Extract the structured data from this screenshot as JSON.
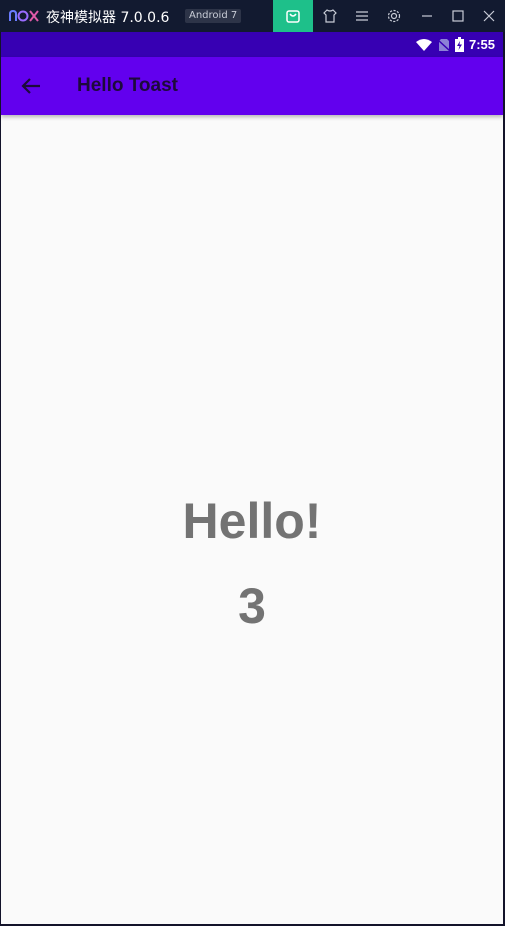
{
  "emulator": {
    "title": "夜神模拟器 7.0.0.6",
    "android_badge": "Android 7",
    "icons": [
      "nox-logo-icon",
      "store-icon",
      "shirt-icon",
      "menu-icon",
      "gear-icon",
      "minimize-icon",
      "maximize-icon",
      "close-icon"
    ],
    "colors": {
      "titlebar": "#121a30",
      "store_accent": "#1ec08a"
    }
  },
  "statusbar": {
    "time": "7:55",
    "icons": [
      "wifi-icon",
      "no-sim-icon",
      "battery-charging-icon"
    ],
    "color": "#3700b3"
  },
  "appbar": {
    "title": "Hello Toast",
    "back_icon": "arrow-back-icon",
    "color": "#6200ee"
  },
  "main": {
    "hello_text": "Hello!",
    "count_text": "3",
    "text_color": "#737373",
    "background": "#fafafa"
  }
}
